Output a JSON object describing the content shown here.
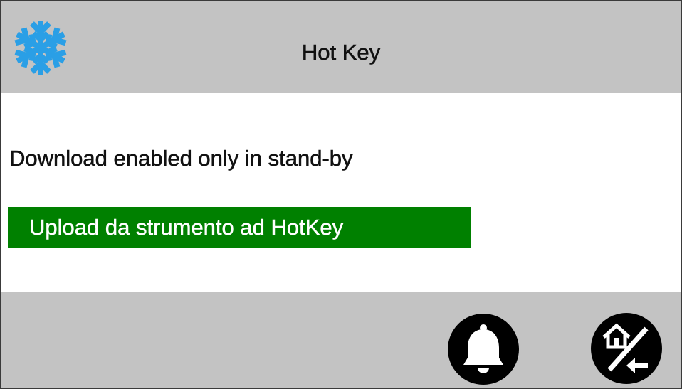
{
  "header": {
    "title": "Hot Key",
    "mode_icon": "snowflake-icon"
  },
  "content": {
    "message": "Download enabled only in stand-by",
    "action_label": "Upload da strumento ad HotKey"
  },
  "footer": {
    "alarm_icon": "bell-icon",
    "home_icon": "home-back-icon"
  },
  "colors": {
    "bar_background": "#c3c3c3",
    "content_background": "#ffffff",
    "action_green": "#008000",
    "snowflake_blue": "#2a9fe6",
    "button_black": "#000000"
  }
}
